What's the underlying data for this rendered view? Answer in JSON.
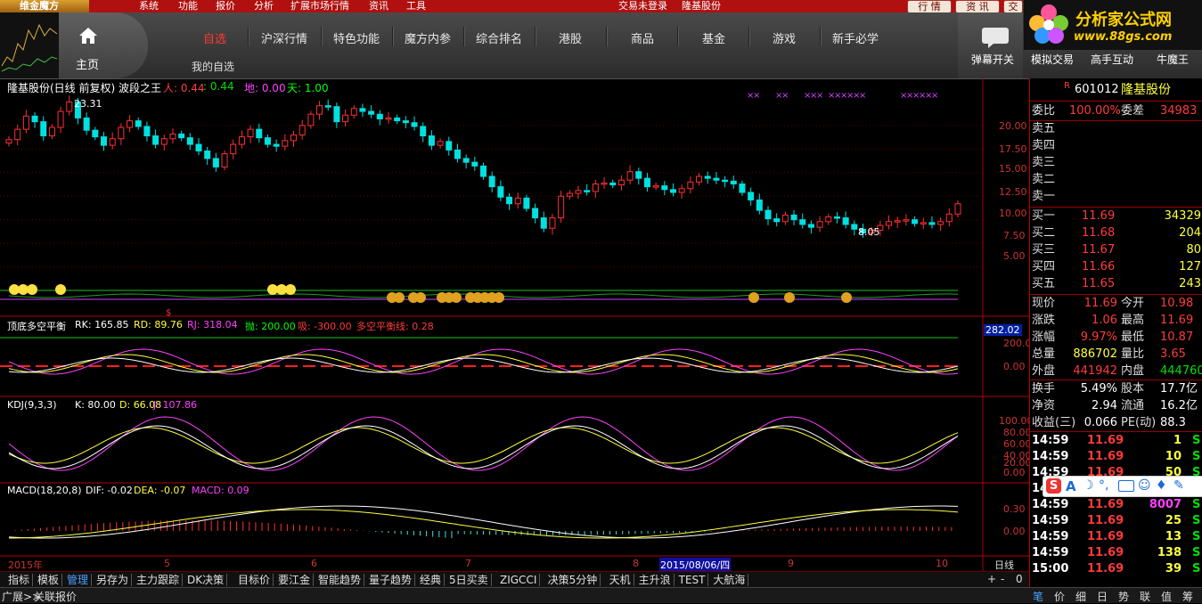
{
  "menu": {
    "logo": "维金魔方",
    "items": [
      "系统",
      "功能",
      "报价",
      "分析",
      "扩展市场行情",
      "资讯",
      "工具"
    ],
    "center_status": "交易未登录",
    "center_stock": "隆基股份",
    "right_buttons": [
      "行 情",
      "资 讯",
      "交"
    ]
  },
  "brand": {
    "title": "分析家公式网",
    "url": "www.88gs.com"
  },
  "nav": {
    "home_label": "主页",
    "tabs": [
      "自选",
      "沪深行情",
      "特色功能",
      "魔方内参",
      "综合排名",
      "港股",
      "商品",
      "基金",
      "游戏",
      "新手必学"
    ],
    "active_tab": "自选",
    "subtab": "我的自选",
    "tools": [
      "弹幕开关",
      "模拟交易",
      "高手互动",
      "牛魔王"
    ]
  },
  "main_chart": {
    "title": "隆基股份(日线 前复权) 波段之王",
    "indicators": [
      {
        "label": "人: 0.44",
        "color": "#ff3b3b"
      },
      {
        "label": ": 0.44",
        "color": "#00e000"
      },
      {
        "label": "地: 0.00",
        "color": "#ff40ff"
      },
      {
        "label": "天: 1.00",
        "color": "#00ff00"
      }
    ],
    "y_ticks": [
      "20.00",
      "17.50",
      "15.00",
      "12.50",
      "10.00",
      "7.50",
      "5.00"
    ],
    "high_label": "23.31",
    "low_label": "8.05",
    "side_price": "282.02"
  },
  "chart_data": {
    "type": "candlestick",
    "title": "隆基股份(日线 前复权) 波段之王",
    "ylim": [
      2.5,
      25
    ],
    "close": [
      18.5,
      19.6,
      21.0,
      20.4,
      18.9,
      19.8,
      21.5,
      22.5,
      20.8,
      19.5,
      18.8,
      17.9,
      18.6,
      19.8,
      20.5,
      19.9,
      18.9,
      18.0,
      18.6,
      19.1,
      18.7,
      18.0,
      17.3,
      16.5,
      15.6,
      17.0,
      18.0,
      18.8,
      19.6,
      18.7,
      18.0,
      17.8,
      18.4,
      19.0,
      20.0,
      21.2,
      22.1,
      22.0,
      20.4,
      21.1,
      21.8,
      21.5,
      21.2,
      20.7,
      20.8,
      20.5,
      20.3,
      19.9,
      18.9,
      17.9,
      18.3,
      17.4,
      16.5,
      16.1,
      15.7,
      14.6,
      13.5,
      12.4,
      11.7,
      12.3,
      11.2,
      10.2,
      9.1,
      10.2,
      12.5,
      12.8,
      13.1,
      13.0,
      13.8,
      13.9,
      13.7,
      14.2,
      15.1,
      14.4,
      13.5,
      13.6,
      13.2,
      12.9,
      13.3,
      14.0,
      14.6,
      14.4,
      14.2,
      14.1,
      13.8,
      12.9,
      12.1,
      11.0,
      10.1,
      9.8,
      10.5,
      10.0,
      9.5,
      9.2,
      9.8,
      10.3,
      10.2,
      9.5,
      9.0,
      8.6,
      8.9,
      9.4,
      9.8,
      9.9,
      10.0,
      9.6,
      9.7,
      9.5,
      9.8,
      10.6,
      11.69
    ],
    "kdj_panel": {
      "label": "KDJ(9,3,3)",
      "K": "80.00",
      "D": "66.08",
      "J": "107.86",
      "y_ticks": [
        "100.00",
        "80.00",
        "60.00",
        "40.00",
        "20.00",
        "0.00"
      ]
    },
    "macd_panel": {
      "label": "MACD(18,20,8)",
      "DIF": "-0.02",
      "DEA": "-0.07",
      "MACD": "0.09",
      "y_ticks": [
        "0.30",
        "0.00"
      ]
    },
    "balance_panel": {
      "label": "顶底多空平衡",
      "RK": "165.85",
      "RD": "89.76",
      "RJ": "318.04",
      "pao": "200.00",
      "xi": "-300.00",
      "line": "0.28",
      "y_ticks": [
        "200.0",
        "0.00"
      ]
    },
    "x_labels": [
      "2015年",
      "5",
      "6",
      "7",
      "8",
      "2015/08/06/四",
      "9",
      "10"
    ],
    "period": "日线"
  },
  "bottom_tabs": [
    "指标",
    "模板",
    "管理",
    "另存为",
    "主力跟踪",
    "DK决策",
    "目标价",
    "要江金",
    "智能趋势",
    "量子趋势",
    "经典",
    "5日买卖",
    "ZIGCCI",
    "决策5分钟",
    "天机",
    "主升浪",
    "TEST",
    "大航海"
  ],
  "bottom_tab_selected": "管理",
  "status": [
    "广展>>",
    "关联报价"
  ],
  "quote": {
    "code": "601012",
    "name": "隆基股份",
    "weibi_label": "委比",
    "weibi": "100.00%",
    "weicha_label": "委差",
    "weicha": "34983",
    "sells": [
      "卖五",
      "卖四",
      "卖三",
      "卖二",
      "卖一"
    ],
    "buys": [
      {
        "label": "买一",
        "price": "11.69",
        "vol": "34329"
      },
      {
        "label": "买二",
        "price": "11.68",
        "vol": "204"
      },
      {
        "label": "买三",
        "price": "11.67",
        "vol": "80"
      },
      {
        "label": "买四",
        "price": "11.66",
        "vol": "127"
      },
      {
        "label": "买五",
        "price": "11.65",
        "vol": "243"
      }
    ],
    "stats": [
      {
        "l1": "现价",
        "v1": "11.69",
        "c1": "red",
        "l2": "今开",
        "v2": "10.98",
        "c2": "red"
      },
      {
        "l1": "涨跌",
        "v1": "1.06",
        "c1": "red",
        "l2": "最高",
        "v2": "11.69",
        "c2": "red"
      },
      {
        "l1": "涨幅",
        "v1": "9.97%",
        "c1": "red",
        "l2": "最低",
        "v2": "10.87",
        "c2": "red"
      },
      {
        "l1": "总量",
        "v1": "886702",
        "c1": "yel",
        "l2": "量比",
        "v2": "3.65",
        "c2": "red"
      },
      {
        "l1": "外盘",
        "v1": "441942",
        "c1": "red",
        "l2": "内盘",
        "v2": "444760",
        "c2": "grn"
      }
    ],
    "fin": [
      {
        "l1": "换手",
        "v1": "5.49%",
        "l2": "股本",
        "v2": "17.7亿"
      },
      {
        "l1": "净资",
        "v1": "2.94",
        "l2": "流通",
        "v2": "16.2亿"
      },
      {
        "l1": "收益(三)",
        "v1": "0.066",
        "l2": "PE(动)",
        "v2": "88.3"
      }
    ],
    "ticks": [
      {
        "t": "14:59",
        "p": "11.69",
        "v": "1",
        "s": "S",
        "c": "yel"
      },
      {
        "t": "14:59",
        "p": "11.69",
        "v": "10",
        "s": "S",
        "c": "yel"
      },
      {
        "t": "14:59",
        "p": "11.69",
        "v": "50",
        "s": "S",
        "c": "yel"
      },
      {
        "t": "14:59",
        "p": "11.69",
        "v": "",
        "s": "",
        "c": "yel"
      },
      {
        "t": "14:59",
        "p": "11.69",
        "v": "8007",
        "s": "S",
        "c": "mag"
      },
      {
        "t": "14:59",
        "p": "11.69",
        "v": "25",
        "s": "S",
        "c": "yel"
      },
      {
        "t": "14:59",
        "p": "11.69",
        "v": "13",
        "s": "S",
        "c": "yel"
      },
      {
        "t": "14:59",
        "p": "11.69",
        "v": "138",
        "s": "S",
        "c": "yel"
      },
      {
        "t": "15:00",
        "p": "11.69",
        "v": "39",
        "s": "S",
        "c": "yel"
      }
    ],
    "bottom_tabs": [
      "笔",
      "价",
      "细",
      "日",
      "势",
      "联",
      "值",
      "筹"
    ]
  }
}
